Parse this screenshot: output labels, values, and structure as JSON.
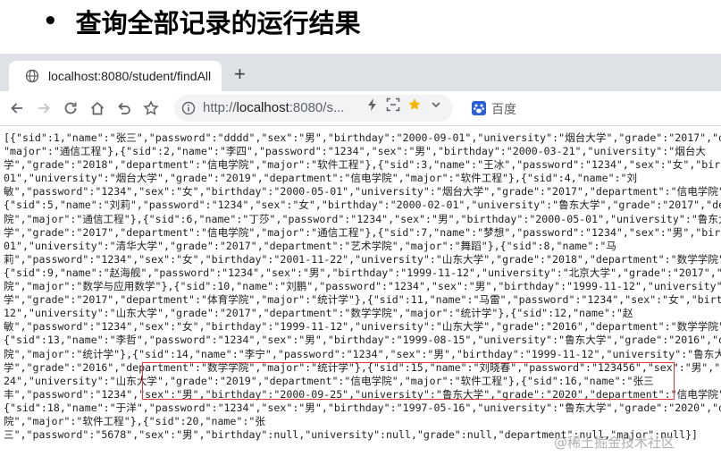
{
  "slide": {
    "bullet": "•",
    "title": "查询全部记录的运行结果"
  },
  "browser": {
    "tab_title": "localhost:8080/student/findAll",
    "newtab_label": "+",
    "url_prefix": "http://",
    "url_host": "localhost",
    "url_rest": ":8080/s...",
    "search_engine": "百度"
  },
  "response": {
    "lines": [
      "[{\"sid\":1,\"name\":\"张三\",\"password\":\"dddd\",\"sex\":\"男\",\"birthday\":\"2000-09-01\",\"university\":\"烟台大学\",\"grade\":\"2017\",\"department",
      "\"major\":\"通信工程\"},{\"sid\":2,\"name\":\"李四\",\"password\":\"1234\",\"sex\":\"男\",\"birthday\":\"2000-03-21\",\"university\":\"烟台大",
      "学\",\"grade\":\"2018\",\"department\":\"信电学院\",\"major\":\"软件工程\"},{\"sid\":3,\"name\":\"王冰\",\"password\":\"1234\",\"sex\":\"女\",\"birthday",
      "01\",\"university\":\"烟台大学\",\"grade\":\"2019\",\"department\":\"信电学院\",\"major\":\"软件工程\"},{\"sid\":4,\"name\":\"刘",
      "敏\",\"password\":\"1234\",\"sex\":\"女\",\"birthday\":\"2000-05-01\",\"university\":\"烟台大学\",\"grade\":\"2017\",\"department\":\"信电学院\",\"maj",
      "{\"sid\":5,\"name\":\"刘莉\",\"password\":\"1234\",\"sex\":\"女\",\"birthday\":\"2000-02-01\",\"university\":\"鲁东大学\",\"grade\":\"2017\",\"departmen",
      "院\",\"major\":\"通信工程\"},{\"sid\":6,\"name\":\"丁莎\",\"password\":\"1234\",\"sex\":\"男\",\"birthday\":\"2000-05-01\",\"university\":\"鲁东大",
      "学\",\"grade\":\"2017\",\"department\":\"信电学院\",\"major\":\"通信工程\"},{\"sid\":7,\"name\":\"梦想\",\"password\":\"1234\",\"sex\":\"男\",\"birthday",
      "01\",\"university\":\"清华大学\",\"grade\":\"2017\",\"department\":\"艺术学院\",\"major\":\"舞蹈\"},{\"sid\":8,\"name\":\"马",
      "莉\",\"password\":\"1234\",\"sex\":\"女\",\"birthday\":\"2001-11-22\",\"university\":\"山东大学\",\"grade\":\"2018\",\"department\":\"数学学院\",\"major",
      "{\"sid\":9,\"name\":\"赵海舰\",\"password\":\"1234\",\"sex\":\"男\",\"birthday\":\"1999-11-12\",\"university\":\"北京大学\",\"grade\":\"2017\",\"departm",
      "院\",\"major\":\"数学与应用数学\"},{\"sid\":10,\"name\":\"刘鹏\",\"password\":\"1234\",\"sex\":\"男\",\"birthday\":\"1999-11-12\",\"university\":\"南开",
      "学\",\"grade\":\"2017\",\"department\":\"体育学院\",\"major\":\"统计学\"},{\"sid\":11,\"name\":\"马雷\",\"password\":\"1234\",\"sex\":\"女\",\"birthday",
      "12\",\"university\":\"山东大学\",\"grade\":\"2017\",\"department\":\"数学学院\",\"major\":\"统计学\"},{\"sid\":12,\"name\":\"赵",
      "敏\",\"password\":\"1234\",\"sex\":\"女\",\"birthday\":\"1999-11-12\",\"university\":\"山东大学\",\"grade\":\"2016\",\"department\":\"数学学院\",\"maj",
      "{\"sid\":13,\"name\":\"李哲\",\"password\":\"1234\",\"sex\":\"男\",\"birthday\":\"1999-08-15\",\"university\":\"鲁东大学\",\"grade\":\"2016\",\"departme",
      "院\",\"major\":\"统计学\"},{\"sid\":14,\"name\":\"李宁\",\"password\":\"1234\",\"sex\":\"男\",\"birthday\":\"1999-11-12\",\"university\":\"鲁东大",
      "学\",\"grade\":\"2016\",\"department\":\"数学学院\",\"major\":\"统计学\"},{\"sid\":15,\"name\":\"刘晓春\",\"password\":\"123456\",\"sex\":\"男\",\"birth",
      "24\",\"university\":\"山东大学\",\"grade\":\"2019\",\"department\":\"信电学院\",\"major\":\"软件工程\"},{\"sid\":16,\"name\":\"张三",
      "丰\",\"password\":\"1234\",\"sex\":\"男\",\"birthday\":\"2000-09-25\",\"university\":\"鲁东大学\",\"grade\":\"2020\",\"department\":\"信电学院\",\"majo",
      "{\"sid\":18,\"name\":\"于洋\",\"password\":\"1234\",\"sex\":\"男\",\"birthday\":\"1997-05-16\",\"university\":\"鲁东大学\",\"grade\":\"2020\",\"departme",
      "院\",\"major\":\"软件工程\"},{\"sid\":20,\"name\":\"张",
      "三\",\"password\":\"5678\",\"sex\":\"男\",\"birthday\":null,\"university\":null,\"grade\":null,\"department\":null,\"major\":null}]"
    ]
  },
  "watermark": "@稀土掘金技术社区"
}
